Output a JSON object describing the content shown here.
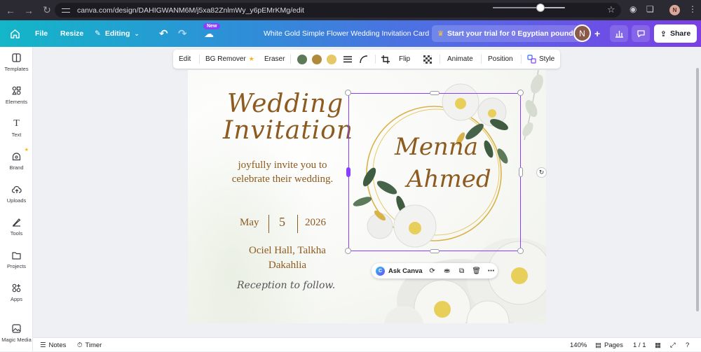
{
  "browser": {
    "url": "canva.com/design/DAHIGWANM6M/j5xa82ZnlmWy_y6pEMrKMg/edit",
    "profile_initial": "N"
  },
  "header": {
    "file_label": "File",
    "resize_label": "Resize",
    "editing_label": "Editing",
    "new_badge": "New",
    "doc_title": "White Gold Simple Flower Wedding Invitation Card",
    "trial_label": "Start your trial for 0 Egyptian pounds",
    "user_initial": "N",
    "share_label": "Share"
  },
  "sidebar": {
    "items": [
      {
        "label": "Templates",
        "icon": "templates-icon"
      },
      {
        "label": "Elements",
        "icon": "elements-icon"
      },
      {
        "label": "Text",
        "icon": "text-icon"
      },
      {
        "label": "Brand",
        "icon": "brand-icon"
      },
      {
        "label": "Uploads",
        "icon": "uploads-icon"
      },
      {
        "label": "Tools",
        "icon": "tools-icon"
      },
      {
        "label": "Projects",
        "icon": "projects-icon"
      },
      {
        "label": "Apps",
        "icon": "apps-icon"
      },
      {
        "label": "Magic Media",
        "icon": "magic-media-icon"
      }
    ]
  },
  "toolbar": {
    "edit": "Edit",
    "bg_remover": "BG Remover",
    "eraser": "Eraser",
    "swatches": [
      "#5c7a5a",
      "#b08a3a",
      "#e6c868"
    ],
    "flip": "Flip",
    "animate": "Animate",
    "position": "Position",
    "style": "Style"
  },
  "design": {
    "title_line1": "Wedding",
    "title_line2": "Invitation",
    "invite_text": "joyfully invite you to celebrate their wedding.",
    "date_month": "May",
    "date_day": "5",
    "date_year": "2026",
    "venue_line1": "Ociel Hall, Talkha",
    "venue_line2": "Dakahlia",
    "reception": "Reception to follow.",
    "name1": "Menna",
    "name2": "Ahmed"
  },
  "askbar": {
    "label": "Ask Canva"
  },
  "bottom": {
    "notes": "Notes",
    "timer": "Timer",
    "zoom": "140%",
    "pages": "Pages",
    "page_count": "1 / 1"
  }
}
